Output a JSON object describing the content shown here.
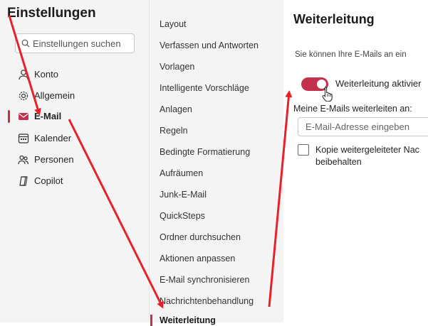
{
  "settings": {
    "title": "Einstellungen",
    "search_placeholder": "Einstellungen suchen",
    "nav": [
      {
        "label": "Konto",
        "icon": "person-icon"
      },
      {
        "label": "Allgemein",
        "icon": "gear-icon"
      },
      {
        "label": "E-Mail",
        "icon": "mail-icon",
        "active": true
      },
      {
        "label": "Kalender",
        "icon": "calendar-icon"
      },
      {
        "label": "Personen",
        "icon": "people-icon"
      },
      {
        "label": "Copilot",
        "icon": "copilot-icon"
      }
    ]
  },
  "mail_menu": {
    "items": [
      "Layout",
      "Verfassen und Antworten",
      "Vorlagen",
      "Intelligente Vorschläge",
      "Anlagen",
      "Regeln",
      "Bedingte Formatierung",
      "Aufräumen",
      "Junk-E-Mail",
      "QuickSteps",
      "Ordner durchsuchen",
      "Aktionen anpassen",
      "E-Mail synchronisieren",
      "Nachrichtenbehandlung",
      "Weiterleitung"
    ],
    "active": "Weiterleitung"
  },
  "forwarding": {
    "title": "Weiterleitung",
    "description": "Sie können Ihre E-Mails an ein",
    "toggle_label": "Weiterleitung aktivier",
    "toggle_on": true,
    "forward_to_label": "Meine E-Mails weiterleiten an:",
    "email_placeholder": "E-Mail-Adresse eingeben",
    "keep_copy_line1": "Kopie weitergeleiteter Nac",
    "keep_copy_line2": "beibehalten"
  },
  "colors": {
    "accent": "#c4314b",
    "annotation_arrow": "#e8202a"
  }
}
